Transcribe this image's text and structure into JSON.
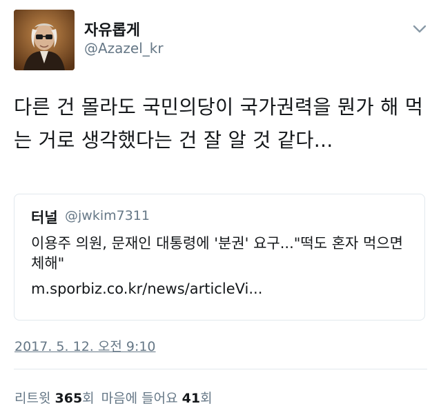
{
  "author": {
    "name": "자유롭게",
    "handle": "@Azazel_kr"
  },
  "tweet": {
    "text": "다른 건 몰라도 국민의당이 국가권력을 뭔가 해 먹는 거로 생각했다는 건 잘 알 것 같다..."
  },
  "quote": {
    "author_name": "터널",
    "author_handle": "@jwkim7311",
    "text": "이용주 의원, 문재인 대통령에 '분권' 요구...\"떡도 혼자 먹으면 체해\"",
    "link": "m.sporbiz.co.kr/news/articleVi..."
  },
  "timestamp": "2017. 5. 12. 오전 9:10",
  "stats": {
    "retweet_label": "리트윗",
    "retweet_count": "365",
    "retweet_suffix": "회",
    "like_label": "마음에 들어요",
    "like_count": "41",
    "like_suffix": "회"
  },
  "icons": {
    "menu": "chevron-down-icon"
  },
  "colors": {
    "primary_text": "#14171a",
    "secondary_text": "#657786",
    "border": "#e1e8ed"
  }
}
